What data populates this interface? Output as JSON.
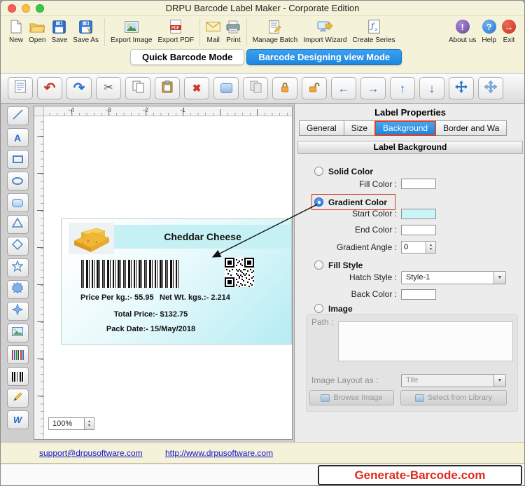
{
  "window": {
    "title": "DRPU Barcode Label Maker - Corporate Edition"
  },
  "main_toolbar": {
    "items": [
      {
        "label": "New",
        "icon": "new-document-icon"
      },
      {
        "label": "Open",
        "icon": "open-folder-icon"
      },
      {
        "label": "Save",
        "icon": "save-icon"
      },
      {
        "label": "Save As",
        "icon": "save-as-icon"
      },
      {
        "label": "Export Image",
        "icon": "export-image-icon"
      },
      {
        "label": "Export PDF",
        "icon": "export-pdf-icon"
      },
      {
        "label": "Mail",
        "icon": "mail-icon"
      },
      {
        "label": "Print",
        "icon": "print-icon"
      },
      {
        "label": "Manage Batch",
        "icon": "manage-batch-icon"
      },
      {
        "label": "Import Wizard",
        "icon": "import-wizard-icon"
      },
      {
        "label": "Create Series",
        "icon": "create-series-icon"
      }
    ],
    "right_items": [
      {
        "label": "About us",
        "icon": "about-icon"
      },
      {
        "label": "Help",
        "icon": "help-icon"
      },
      {
        "label": "Exit",
        "icon": "exit-icon"
      }
    ]
  },
  "mode_tabs": {
    "quick_label": "Quick Barcode Mode",
    "design_label": "Barcode Designing view Mode",
    "active": "Barcode Designing view Mode"
  },
  "edit_toolbar": {
    "icons": [
      "report-icon",
      "undo-icon",
      "redo-icon",
      "cut-icon",
      "copy-icon",
      "paste-icon",
      "delete-icon",
      "fill-color-icon",
      "copy-style-icon",
      "lock-icon",
      "unlock-icon",
      "arrow-left-icon",
      "arrow-right-icon",
      "arrow-up-icon",
      "arrow-down-icon",
      "move-icon",
      "center-object-icon"
    ]
  },
  "tools_sidebar": {
    "tools": [
      "line",
      "text",
      "rectangle",
      "ellipse",
      "rounded-rectangle",
      "triangle",
      "diamond",
      "star",
      "seal",
      "four-point-star",
      "image",
      "colored-barcode",
      "barcode",
      "pencil",
      "watermark"
    ]
  },
  "canvas": {
    "ruler_numbers": [
      "-4",
      "-3",
      "-2",
      "-1"
    ],
    "zoom": "100%"
  },
  "label_design": {
    "product_name": "Cheddar Cheese",
    "price_per_kg": "Price Per kg.:- 55.95",
    "net_weight": "Net Wt. kgs.:- 2.214",
    "total_price": "Total Price:- $132.75",
    "pack_date": "Pack Date:- 15/May/2018"
  },
  "properties_panel": {
    "title": "Label Properties",
    "tabs": [
      {
        "label": "General",
        "active": false
      },
      {
        "label": "Size",
        "active": false
      },
      {
        "label": "Background",
        "active": true
      },
      {
        "label": "Border and Wa",
        "active": false
      }
    ],
    "section_title": "Label Background",
    "solid_color_label": "Solid Color",
    "fill_color_label": "Fill Color :",
    "gradient_color_label": "Gradient Color",
    "start_color_label": "Start Color :",
    "end_color_label": "End Color :",
    "gradient_angle_label": "Gradient Angle :",
    "gradient_angle_value": "0",
    "fill_style_label": "Fill Style",
    "hatch_style_label": "Hatch Style :",
    "hatch_style_value": "Style-1",
    "back_color_label": "Back Color :",
    "image_label": "Image",
    "path_label": "Path :",
    "image_layout_label": "Image Layout as :",
    "image_layout_value": "Tile",
    "browse_button": "Browse Image",
    "library_button": "Select from Library",
    "selected_option": "Gradient Color"
  },
  "footer": {
    "support_link": "support@drpusoftware.com",
    "website_link": "http://www.drpusoftware.com"
  },
  "badge": {
    "text": "Generate-Barcode.com"
  },
  "colors": {
    "accent_blue": "#1f86dc",
    "highlight_red": "#cc3b22",
    "titlebar_cream": "#f5f2da",
    "start_color_swatch": "#c9f4f8",
    "end_color_swatch": "#ffffff",
    "fill_color_swatch": "#ffffff",
    "back_color_swatch": "#ffffff"
  }
}
